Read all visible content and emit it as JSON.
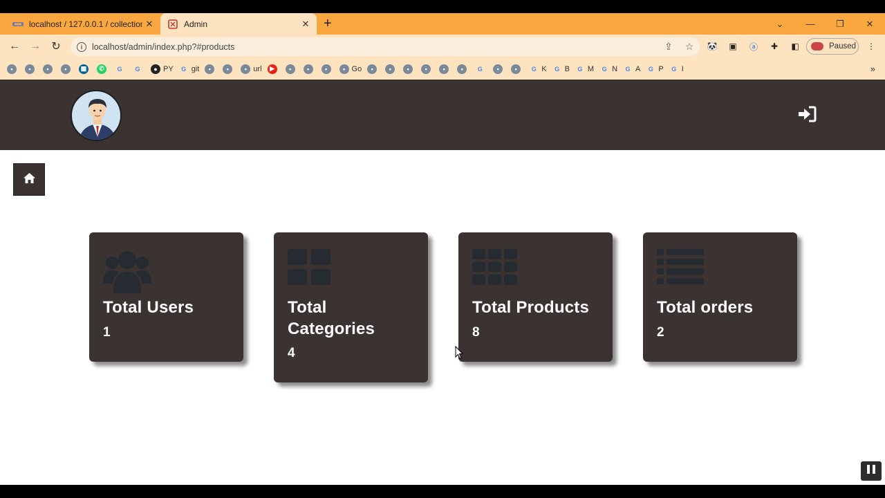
{
  "browser": {
    "tabs": [
      {
        "title": "localhost / 127.0.0.1 / collection",
        "favicon": "phpmyadmin-icon",
        "active": false
      },
      {
        "title": "Admin",
        "favicon": "admin-icon",
        "active": true
      }
    ],
    "address": "localhost/admin/index.php?#products",
    "profile_status": "Paused",
    "bookmarks": [
      {
        "label": "",
        "icon": "bookmark-icon"
      },
      {
        "label": "",
        "icon": "bookmark-icon"
      },
      {
        "label": "",
        "icon": "bookmark-icon"
      },
      {
        "label": "",
        "icon": "bookmark-icon"
      },
      {
        "label": "",
        "icon": "ieee-icon"
      },
      {
        "label": "",
        "icon": "whatsapp-icon"
      },
      {
        "label": "",
        "icon": "google-icon"
      },
      {
        "label": "",
        "icon": "google-icon"
      },
      {
        "label": "PY",
        "icon": "github-icon"
      },
      {
        "label": "git",
        "icon": "google-icon"
      },
      {
        "label": "",
        "icon": "bookmark-icon"
      },
      {
        "label": "",
        "icon": "bookmark-icon"
      },
      {
        "label": "url",
        "icon": "bookmark-icon"
      },
      {
        "label": "",
        "icon": "youtube-icon"
      },
      {
        "label": "",
        "icon": "bookmark-icon"
      },
      {
        "label": "",
        "icon": "bookmark-icon"
      },
      {
        "label": "",
        "icon": "bookmark-icon"
      },
      {
        "label": "Go",
        "icon": "bookmark-icon"
      },
      {
        "label": "",
        "icon": "bookmark-icon"
      },
      {
        "label": "",
        "icon": "bookmark-icon"
      },
      {
        "label": "",
        "icon": "bookmark-icon"
      },
      {
        "label": "",
        "icon": "bookmark-icon"
      },
      {
        "label": "",
        "icon": "bookmark-icon"
      },
      {
        "label": "",
        "icon": "bookmark-icon"
      },
      {
        "label": "",
        "icon": "google-icon"
      },
      {
        "label": "",
        "icon": "bookmark-icon"
      },
      {
        "label": "",
        "icon": "bookmark-icon"
      },
      {
        "label": "K",
        "icon": "google-icon"
      },
      {
        "label": "B",
        "icon": "google-icon"
      },
      {
        "label": "M",
        "icon": "google-icon"
      },
      {
        "label": "N",
        "icon": "google-icon"
      },
      {
        "label": "A",
        "icon": "google-icon"
      },
      {
        "label": "P",
        "icon": "google-icon"
      },
      {
        "label": "I",
        "icon": "google-icon"
      }
    ]
  },
  "cards": [
    {
      "title": "Total Users",
      "value": "1",
      "icon": "users-icon"
    },
    {
      "title": "Total Categories",
      "value": "4",
      "icon": "th-large-icon"
    },
    {
      "title": "Total Products",
      "value": "8",
      "icon": "th-icon"
    },
    {
      "title": "Total orders",
      "value": "2",
      "icon": "list-icon"
    }
  ],
  "colors": {
    "header_bg": "#3a3331",
    "card_bg": "#3a3331",
    "tabstrip_bg": "#f9a73e",
    "toolbar_bg": "#fde3c0"
  }
}
